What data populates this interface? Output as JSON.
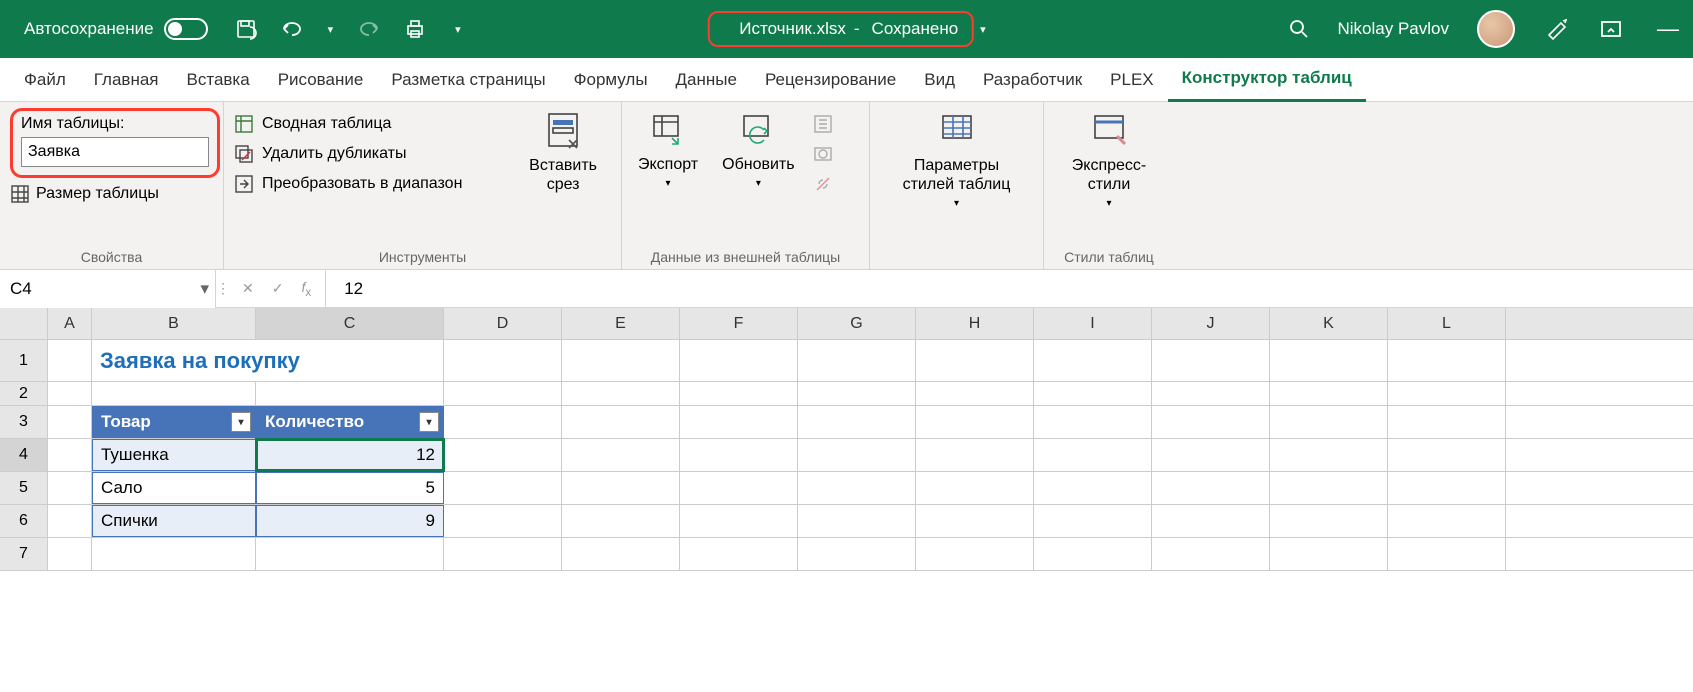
{
  "titlebar": {
    "autosave": "Автосохранение",
    "filename": "Источник.xlsx",
    "saved": "Сохранено",
    "username": "Nikolay Pavlov"
  },
  "tabs": {
    "file": "Файл",
    "home": "Главная",
    "insert": "Вставка",
    "draw": "Рисование",
    "layout": "Разметка страницы",
    "formulas": "Формулы",
    "data": "Данные",
    "review": "Рецензирование",
    "view": "Вид",
    "developer": "Разработчик",
    "plex": "PLEX",
    "tabledesign": "Конструктор таблиц"
  },
  "ribbon": {
    "props": {
      "label": "Свойства",
      "tablename_label": "Имя таблицы:",
      "tablename": "Заявка",
      "resize": "Размер таблицы"
    },
    "tools": {
      "label": "Инструменты",
      "pivot": "Сводная таблица",
      "dedup": "Удалить дубликаты",
      "torange": "Преобразовать в диапазон",
      "slicer": "Вставить срез"
    },
    "external": {
      "label": "Данные из внешней таблицы",
      "export": "Экспорт",
      "refresh": "Обновить"
    },
    "styles": {
      "label": "Стили таблиц",
      "options": "Параметры стилей таблиц",
      "quick": "Экспресс-стили"
    }
  },
  "formula": {
    "namebox": "C4",
    "value": "12"
  },
  "columns": [
    "A",
    "B",
    "C",
    "D",
    "E",
    "F",
    "G",
    "H",
    "I",
    "J",
    "K",
    "L"
  ],
  "rows": [
    "1",
    "2",
    "3",
    "4",
    "5",
    "6",
    "7"
  ],
  "sheet": {
    "title": "Заявка на покупку",
    "headers": {
      "c1": "Товар",
      "c2": "Количество"
    },
    "data": [
      {
        "name": "Тушенка",
        "qty": "12"
      },
      {
        "name": "Сало",
        "qty": "5"
      },
      {
        "name": "Спички",
        "qty": "9"
      }
    ]
  }
}
